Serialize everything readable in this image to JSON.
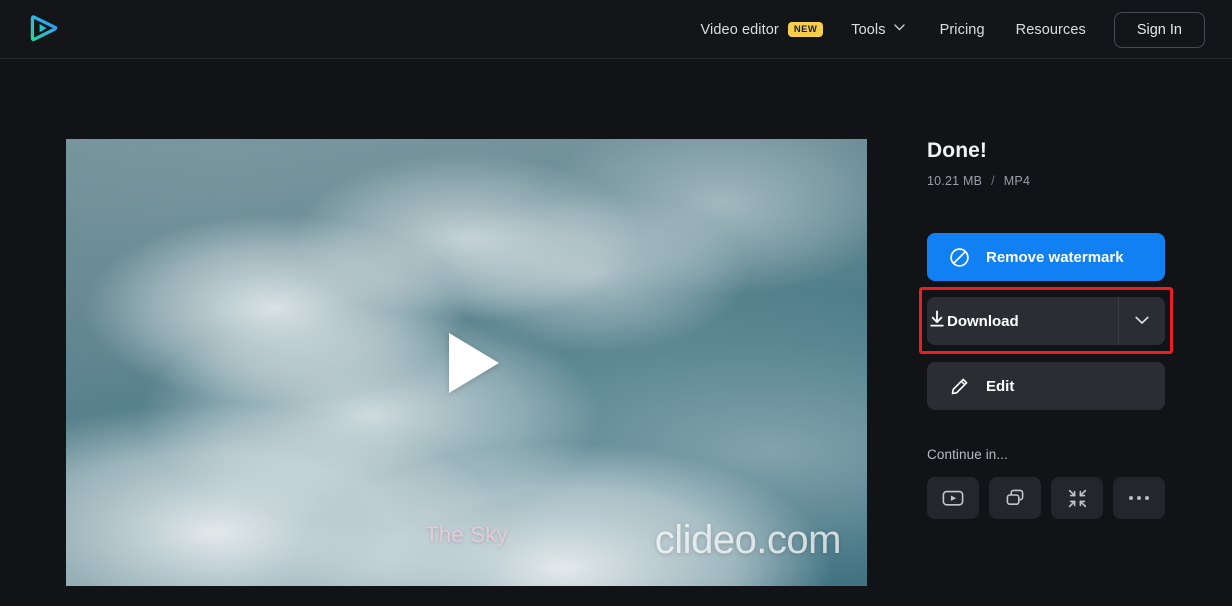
{
  "header": {
    "logo_icon": "play-triangle-logo",
    "nav": [
      {
        "label": "Video editor",
        "badge": "NEW",
        "icon": null
      },
      {
        "label": "Tools",
        "badge": null,
        "icon": "chevron-down-icon"
      },
      {
        "label": "Pricing",
        "badge": null,
        "icon": null
      },
      {
        "label": "Resources",
        "badge": null,
        "icon": null
      }
    ],
    "sign_in_label": "Sign In"
  },
  "video": {
    "caption": "The Sky",
    "watermark": "clideo.com",
    "play_icon": "play-icon"
  },
  "panel": {
    "title": "Done!",
    "file_size": "10.21 MB",
    "separator": "/",
    "file_format": "MP4",
    "remove_watermark_label": "Remove watermark",
    "remove_watermark_icon": "prohibition-icon",
    "download_label": "Download",
    "download_icon": "download-icon",
    "download_dropdown_icon": "chevron-down-icon",
    "edit_label": "Edit",
    "edit_icon": "pencil-icon",
    "continue_label": "Continue in...",
    "continue_actions": [
      {
        "icon": "video-player-icon"
      },
      {
        "icon": "merge-squares-icon"
      },
      {
        "icon": "compress-arrows-icon"
      },
      {
        "icon": "more-dots-icon"
      }
    ]
  },
  "colors": {
    "accent_blue": "#1180f2",
    "badge_yellow": "#f7cf4e",
    "highlight_red": "#ee1d23",
    "background": "#121317",
    "surface": "#2c2d33"
  }
}
